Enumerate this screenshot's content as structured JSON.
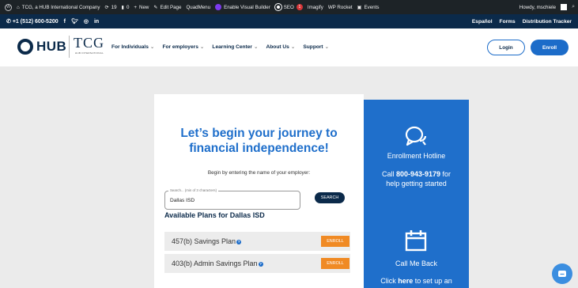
{
  "admin_bar": {
    "site_name": "TCG, a HUB International Company",
    "updates_count": "19",
    "comments_count": "0",
    "new_label": "New",
    "edit_page_label": "Edit Page",
    "quadmenu_label": "QuadMenu",
    "visual_builder_label": "Enable Visual Builder",
    "seo_label": "SEO",
    "seo_badge": "1",
    "imagify_label": "Imagify",
    "wp_rocket_label": "WP Rocket",
    "events_label": "Events",
    "greeting": "Howdy, mschiele"
  },
  "util_bar": {
    "phone": "+1 (512) 600-5200",
    "social": [
      "f",
      "t",
      "ig",
      "in"
    ],
    "links": [
      "Español",
      "Forms",
      "Distribution Tracker"
    ]
  },
  "header": {
    "logo_hub": "HUB",
    "logo_tcg": "TCG",
    "logo_tcg_sub": "HUB INTERNATIONAL",
    "nav": [
      "For Individuals",
      "For employers",
      "Learning Center",
      "About Us",
      "Support"
    ],
    "login_label": "Login",
    "enroll_label": "Enroll"
  },
  "card": {
    "title_line1": "Let’s begin your journey to",
    "title_line2": "financial independence!",
    "intro": "Begin by entering the name of your employer:",
    "search_legend": "Search... (min of 3 characters)",
    "search_value": "Dallas ISD",
    "search_button": "SEARCH",
    "plans_heading": "Available Plans for Dallas ISD",
    "plans": [
      {
        "name": "457(b) Savings Plan",
        "button": "ENROLL"
      },
      {
        "name": "403(b) Admin Savings Plan",
        "button": "ENROLL"
      }
    ]
  },
  "side_panel": {
    "hotline_title": "Enrollment Hotline",
    "hotline_prefix": "Call ",
    "hotline_number": "800-943-9179",
    "hotline_suffix": " for",
    "hotline_line2": "help getting started",
    "callback_title": "Call Me Back",
    "callback_prefix": "Click ",
    "callback_link": "here",
    "callback_suffix": " to set up an"
  },
  "colors": {
    "navy": "#0b2a4a",
    "accent_blue": "#1f6fcb",
    "enroll_orange": "#f08a24"
  }
}
